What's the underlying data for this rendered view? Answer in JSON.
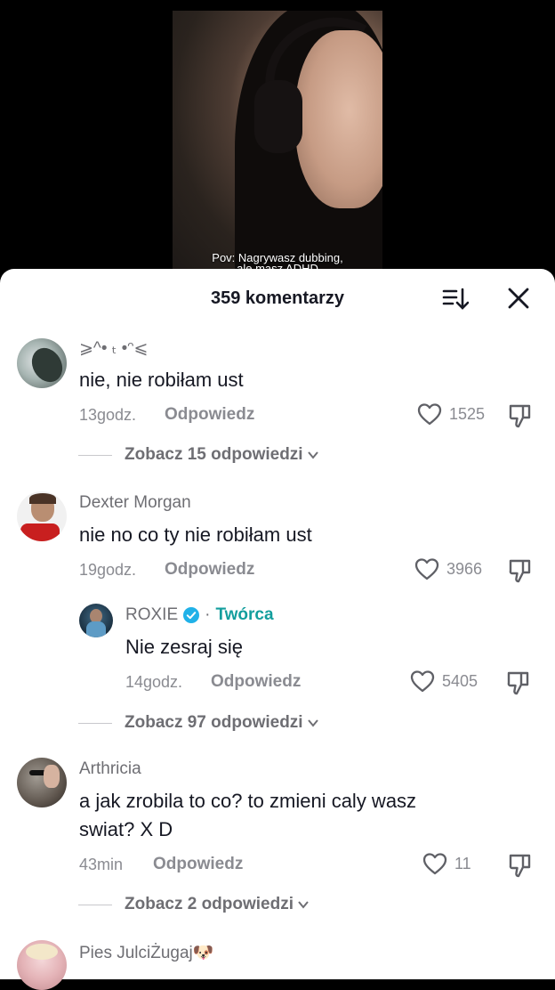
{
  "video": {
    "caption_line1": "Pov: Nagrywasz dubbing,",
    "caption_line2": "ale masz ADHD"
  },
  "sheet": {
    "title": "359 komentarzy"
  },
  "comments": [
    {
      "username": "⩾^• ₜ •ᵔ⩽",
      "text": "nie, nie robiłam ust",
      "time": "13godz.",
      "reply": "Odpowiedz",
      "likes": "1525",
      "view_replies": "Zobacz 15 odpowiedzi"
    },
    {
      "username": "Dexter Morgan",
      "text": "nie no co ty nie robiłam ust",
      "time": "19godz.",
      "reply": "Odpowiedz",
      "likes": "3966",
      "subreply": {
        "username": "ROXIE",
        "separator": "·",
        "creator_label": "Twórca",
        "text": "Nie zesraj się",
        "time": "14godz.",
        "reply": "Odpowiedz",
        "likes": "5405"
      },
      "view_replies": "Zobacz 97 odpowiedzi"
    },
    {
      "username": "Arthricia",
      "text_line1": "a jak zrobila to co? to zmieni caly wasz",
      "text_line2": "swiat? X D",
      "time": "43min",
      "reply": "Odpowiedz",
      "likes": "11",
      "view_replies": "Zobacz 2 odpowiedzi"
    },
    {
      "username": "Pies JulciŻugaj🐶"
    }
  ],
  "colors": {
    "creator": "#139e9d",
    "verified": "#20b1e8",
    "text": "#161823",
    "muted": "#8a8b91"
  }
}
